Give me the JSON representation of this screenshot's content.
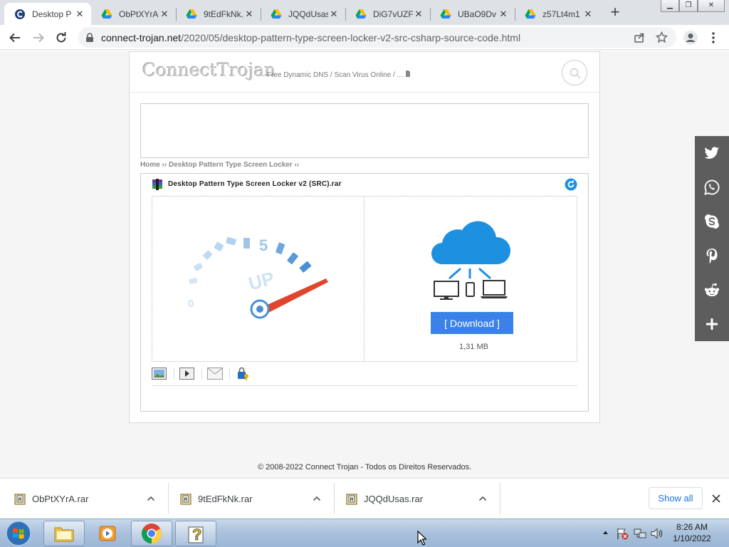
{
  "browser": {
    "tabs": [
      {
        "title": "Desktop P",
        "active": true,
        "icon": "connect-trojan-favicon"
      },
      {
        "title": "ObPtXYrA",
        "active": false,
        "icon": "google-drive-icon"
      },
      {
        "title": "9tEdFkNk.",
        "active": false,
        "icon": "google-drive-icon"
      },
      {
        "title": "JQQdUsas",
        "active": false,
        "icon": "google-drive-icon"
      },
      {
        "title": "DiG7vUZF",
        "active": false,
        "icon": "google-drive-icon"
      },
      {
        "title": "UBaO9Dv",
        "active": false,
        "icon": "google-drive-icon"
      },
      {
        "title": "z57Lt4m1",
        "active": false,
        "icon": "google-drive-icon"
      }
    ],
    "new_tab_glyph": "+",
    "url_host": "connect-trojan.net",
    "url_path": "/2020/05/desktop-pattern-type-screen-locker-v2-src-csharp-source-code.html"
  },
  "site": {
    "logo": "ConnectTrojan",
    "tagline": "Free Dynamic DNS / Scan Virus Online / ...",
    "breadcrumb": "Home ›› Desktop Pattern Type Screen Locker ‹‹",
    "file_title": "Desktop Pattern Type Screen Locker v2 (SRC).rar",
    "download_label": "[ Download ]",
    "file_size": "1,31 MB",
    "speed_number": "5",
    "speed_zero": "0",
    "speed_up": "UP",
    "footer": "© 2008-2022 Connect Trojan - Todos os Direitos Reservados."
  },
  "share": [
    "twitter-icon",
    "whatsapp-icon",
    "skype-icon",
    "pinterest-icon",
    "reddit-icon",
    "plus-icon"
  ],
  "downloads": {
    "items": [
      {
        "name": "ObPtXYrA.rar"
      },
      {
        "name": "9tEdFkNk.rar"
      },
      {
        "name": "JQQdUsas.rar"
      }
    ],
    "show_all": "Show all"
  },
  "taskbar": {
    "time": "8:26 AM",
    "date": "1/10/2022"
  },
  "colors": {
    "download_button": "#3b82e8",
    "share_bar": "#5d5d5d",
    "cloud_blue": "#1e90e0"
  }
}
